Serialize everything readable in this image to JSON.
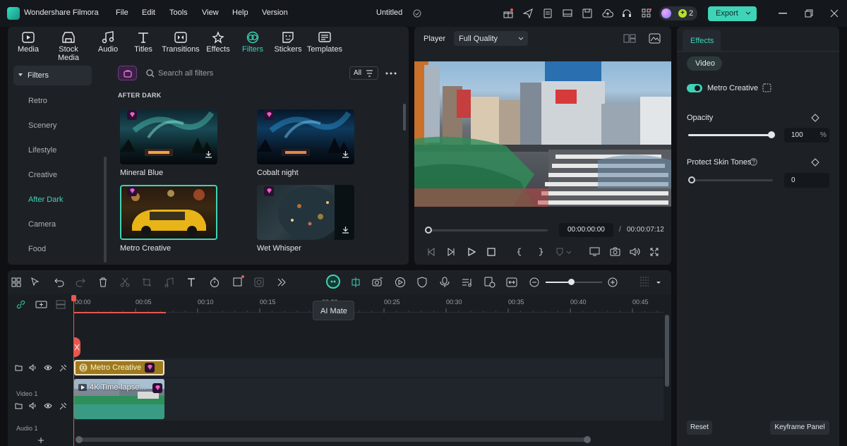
{
  "app": {
    "title": "Wondershare Filmora",
    "project": "Untitled",
    "credits": "2",
    "export_label": "Export"
  },
  "menu": [
    "File",
    "Edit",
    "Tools",
    "View",
    "Help",
    "Version"
  ],
  "toolbar": [
    {
      "label": "Media",
      "icon": "media-icon"
    },
    {
      "label": "Stock Media",
      "icon": "stock-media-icon"
    },
    {
      "label": "Audio",
      "icon": "audio-icon"
    },
    {
      "label": "Titles",
      "icon": "titles-icon"
    },
    {
      "label": "Transitions",
      "icon": "transitions-icon"
    },
    {
      "label": "Effects",
      "icon": "effects-icon"
    },
    {
      "label": "Filters",
      "icon": "filters-icon"
    },
    {
      "label": "Stickers",
      "icon": "stickers-icon"
    },
    {
      "label": "Templates",
      "icon": "templates-icon"
    }
  ],
  "sidebar": {
    "header": "Filters",
    "items": [
      "Retro",
      "Scenery",
      "Lifestyle",
      "Creative",
      "After Dark",
      "Camera",
      "Food"
    ],
    "active": "After Dark"
  },
  "browser": {
    "search_placeholder": "Search all filters",
    "filter_all": "All",
    "section": "AFTER DARK",
    "items": [
      "Mineral Blue",
      "Cobalt night",
      "Metro Creative",
      "Wet Whisper"
    ]
  },
  "player": {
    "label": "Player",
    "quality": "Full Quality",
    "current_time": "00:00:00:00",
    "separator": "/",
    "total_time": "00:00:07:12"
  },
  "effects_panel": {
    "tab": "Effects",
    "subtab": "Video",
    "effect_name": "Metro Creative",
    "opacity_label": "Opacity",
    "opacity_value": "100",
    "opacity_unit": "%",
    "opacity_fraction": 1.0,
    "skin_label": "Protect Skin Tones",
    "skin_value": "0",
    "reset_label": "Reset",
    "keyframe_label": "Keyframe Panel"
  },
  "timeline": {
    "ticks": [
      "00:00",
      "00:05",
      "00:10",
      "00:15",
      "00:20",
      "00:25",
      "00:30",
      "00:35",
      "00:40",
      "00:45"
    ],
    "tooltip": "AI Mate",
    "filter_clip": "Metro Creative",
    "video_clip": "4K Time-lapse...",
    "track_video": "Video 1",
    "track_audio": "Audio 1"
  },
  "colors": {
    "accent": "#3fd3b7",
    "export_bg": "#3fd3b7",
    "clip_gold": "#9e7a1d",
    "playhead": "#e8574f"
  }
}
